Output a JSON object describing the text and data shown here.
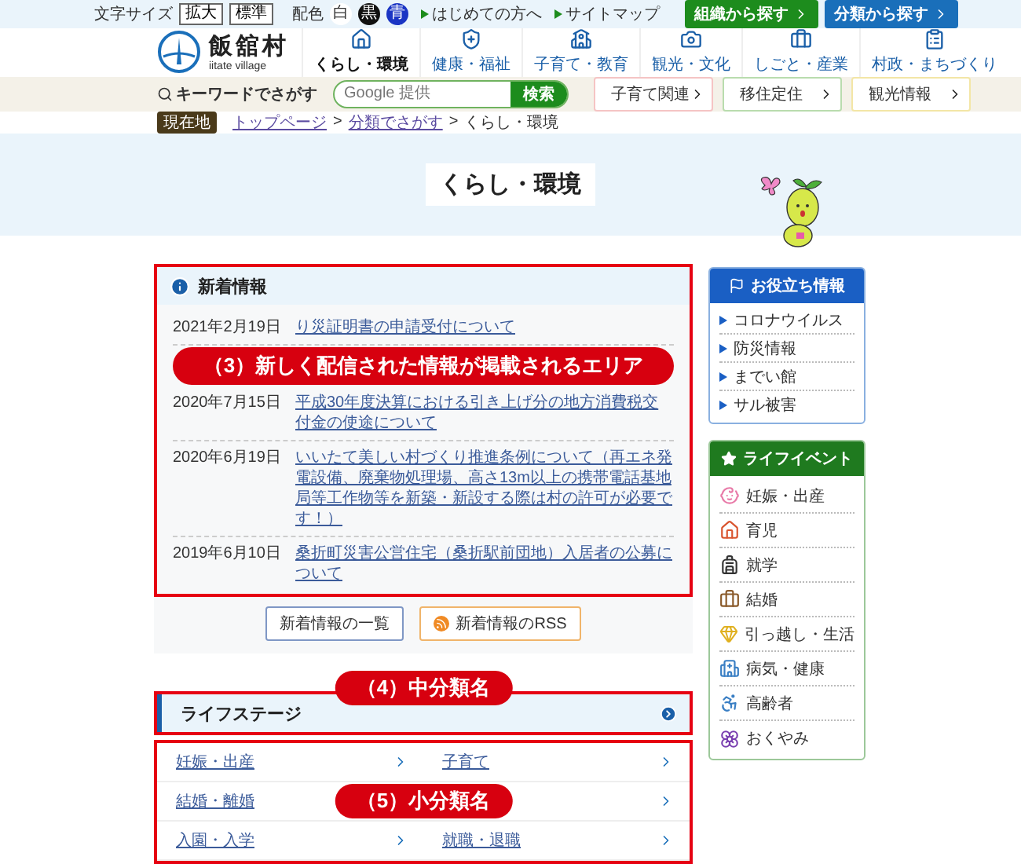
{
  "top_bar": {
    "font_size_label": "文字サイズ",
    "font_size_buttons": [
      "拡大",
      "標準"
    ],
    "color_label": "配色",
    "color_options": [
      {
        "label": "白",
        "color": "#ffffff"
      },
      {
        "label": "黒",
        "color": "#111111"
      },
      {
        "label": "青",
        "color": "#1b35c4"
      }
    ],
    "links": [
      "はじめての方へ",
      "サイトマップ"
    ],
    "buttons": [
      {
        "label": "組織から探す",
        "color": "#1d8c1d"
      },
      {
        "label": "分類から探す",
        "color": "#1a6fba"
      }
    ]
  },
  "logo": {
    "name": "飯舘村",
    "subtitle": "iitate village"
  },
  "nav": [
    {
      "label": "くらし・環境",
      "selected": true
    },
    {
      "label": "健康・福祉",
      "selected": false
    },
    {
      "label": "子育て・教育",
      "selected": false
    },
    {
      "label": "観光・文化",
      "selected": false
    },
    {
      "label": "しごと・産業",
      "selected": false
    },
    {
      "label": "村政・まちづくり",
      "selected": false
    }
  ],
  "search": {
    "label": "キーワードでさがす",
    "placeholder": "Google 提供",
    "button": "検索"
  },
  "quick_links": [
    {
      "label": "子育て関連",
      "color": "#f5c4c4"
    },
    {
      "label": "移住定住",
      "color": "#b9dcae"
    },
    {
      "label": "観光情報",
      "color": "#f3e6a6"
    }
  ],
  "breadcrumb": {
    "label": "現在地",
    "items": [
      {
        "kind": "link",
        "text": "トップページ"
      },
      {
        "kind": "separator",
        "text": ">"
      },
      {
        "kind": "link",
        "text": "分類でさがす"
      },
      {
        "kind": "separator",
        "text": ">"
      },
      {
        "kind": "current",
        "text": "くらし・環境"
      }
    ]
  },
  "page_title": "くらし・環境",
  "news": {
    "title": "新着情報",
    "annotation": "（3）新しく配信された情報が掲載されるエリア",
    "items": [
      {
        "date": "2021年2月19日",
        "title": "り災証明書の申請受付について"
      },
      {
        "date": "2020年7月15日",
        "title": "平成30年度決算における引き上げ分の地方消費税交付金の使途について"
      },
      {
        "date": "2020年6月19日",
        "title": "いいたて美しい村づくり推進条例について（再エネ発電設備、廃棄物処理場、高さ13m以上の携帯電話基地局等工作物等を新築・新設する際は村の許可が必要です！）"
      },
      {
        "date": "2019年6月10日",
        "title": "桑折町災害公営住宅（桑折駅前団地）入居者の公募について"
      }
    ],
    "buttons": [
      {
        "kind": "plain",
        "label": "新着情報の一覧"
      },
      {
        "kind": "rss",
        "label": "新着情報のRSS"
      }
    ]
  },
  "category": {
    "title": "ライフステージ",
    "annotation": "（4）中分類名",
    "items_annotation": "（5）小分類名",
    "items": [
      {
        "label": "妊娠・出産"
      },
      {
        "label": "子育て"
      },
      {
        "label": "結婚・離婚"
      },
      {
        "covered": true
      },
      {
        "label": "入園・入学"
      },
      {
        "label": "就職・退職"
      }
    ]
  },
  "useful": {
    "title": "お役立ち情報",
    "items": [
      "コロナウイルス",
      "防災情報",
      "までい館",
      "サル被害"
    ]
  },
  "life_events": {
    "title": "ライフイベント",
    "items": [
      "妊娠・出産",
      "育児",
      "就学",
      "結婚",
      "引っ越し・生活",
      "病気・健康",
      "高齢者",
      "おくやみ"
    ]
  }
}
